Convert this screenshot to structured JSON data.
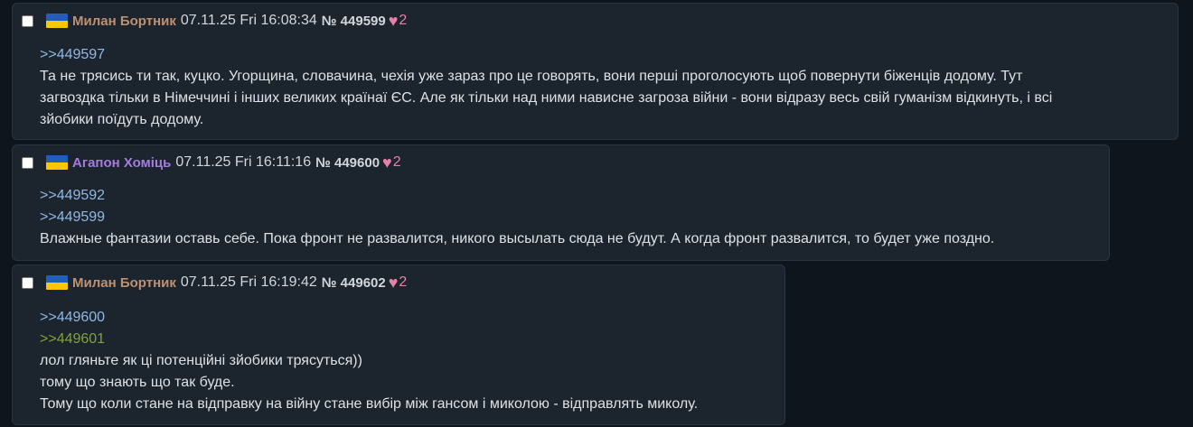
{
  "colors": {
    "flag_blue": "#1f5fb8",
    "flag_yellow": "#f5c800",
    "author_default": "#bd9171",
    "author_alt": "#a57be0",
    "heart": "#e77fa8",
    "reply_link": "#8fb8e4",
    "quote_link": "#7fa33c"
  },
  "icons": {
    "heart": "♥",
    "flag": "ukraine-flag"
  },
  "posts": [
    {
      "author": "Милан Бортник",
      "datetime": "07.11.25 Fri 16:08:34",
      "number": "№ 449599",
      "likes": "2",
      "links": [
        ">>449597"
      ],
      "text_lines": [
        "Та не трясись ти так, куцко. Угорщина, словачина, чехія уже зараз про це говорять, вони перші проголосують щоб повернути біженців додому. Тут",
        "загвоздка тільки в Німеччині і інших великих країнаї ЄС. Але як тільки над ними нависне загроза війни - вони відразу весь свій гуманізм відкинуть, і всі",
        "зйобики поїдуть додому."
      ]
    },
    {
      "author": "Агапон Хоміць",
      "datetime": "07.11.25 Fri 16:11:16",
      "number": "№ 449600",
      "likes": "2",
      "links": [
        ">>449592",
        ">>449599"
      ],
      "text_lines": [
        "Влажные фантазии оставь себе. Пока фронт не развалится, никого высылать сюда не будут. А когда фронт развалится, то будет уже поздно."
      ]
    },
    {
      "author": "Милан Бортник",
      "datetime": "07.11.25 Fri 16:19:42",
      "number": "№ 449602",
      "likes": "2",
      "links": [
        ">>449600"
      ],
      "quoted_links": [
        ">>449601"
      ],
      "text_lines": [
        "лол гляньте як ці потенційні зйобики трясуться))",
        "тому що знають що так буде.",
        "Тому що коли стане на відправку на війну стане вибір між гансом і миколою - відправлять миколу."
      ]
    }
  ]
}
